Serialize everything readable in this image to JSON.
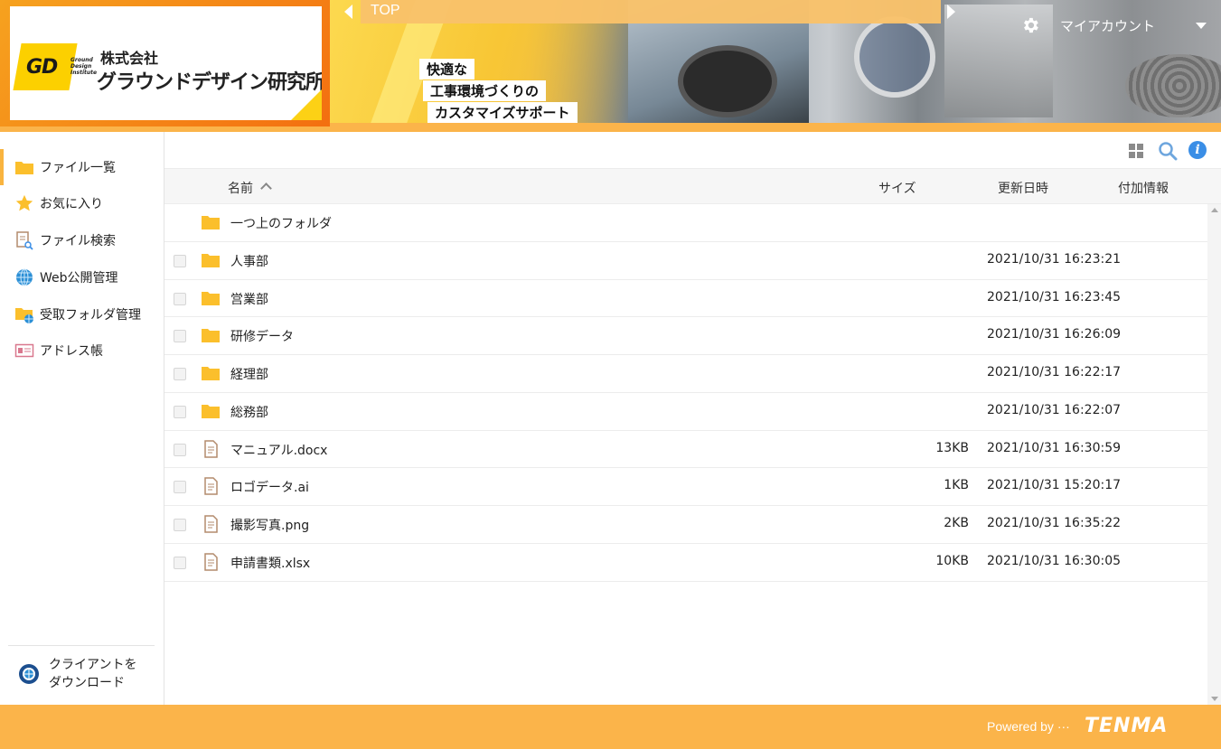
{
  "header": {
    "logo": {
      "mark": "GD",
      "sub_lines": [
        "Ground",
        "Design",
        "Institute"
      ],
      "company_prefix": "株式会社",
      "company_name": "グラウンドデザイン研究所"
    },
    "breadcrumb_top": "TOP",
    "taglines": [
      "快適な",
      "工事環境づくりの",
      "カスタマイズサポート"
    ],
    "account_label": "マイアカウント"
  },
  "sidebar": {
    "items": [
      {
        "label": "ファイル一覧",
        "icon": "folder-icon"
      },
      {
        "label": "お気に入り",
        "icon": "star-icon"
      },
      {
        "label": "ファイル検索",
        "icon": "file-search-icon"
      },
      {
        "label": "Web公開管理",
        "icon": "globe-icon"
      },
      {
        "label": "受取フォルダ管理",
        "icon": "folder-globe-icon"
      },
      {
        "label": "アドレス帳",
        "icon": "address-card-icon"
      }
    ],
    "client_download": [
      "クライアントを",
      "ダウンロード"
    ]
  },
  "table": {
    "columns": {
      "name": "名前",
      "size": "サイズ",
      "date": "更新日時",
      "extra": "付加情報"
    },
    "parent_folder": "一つ上のフォルダ",
    "rows": [
      {
        "type": "folder",
        "name": "人事部",
        "size": "",
        "date": "2021/10/31 16:23:21"
      },
      {
        "type": "folder",
        "name": "営業部",
        "size": "",
        "date": "2021/10/31 16:23:45"
      },
      {
        "type": "folder",
        "name": "研修データ",
        "size": "",
        "date": "2021/10/31 16:26:09"
      },
      {
        "type": "folder",
        "name": "経理部",
        "size": "",
        "date": "2021/10/31 16:22:17"
      },
      {
        "type": "folder",
        "name": "総務部",
        "size": "",
        "date": "2021/10/31 16:22:07"
      },
      {
        "type": "file",
        "name": "マニュアル.docx",
        "size": "13KB",
        "date": "2021/10/31 16:30:59"
      },
      {
        "type": "file",
        "name": "ロゴデータ.ai",
        "size": "1KB",
        "date": "2021/10/31 15:20:17"
      },
      {
        "type": "file",
        "name": "撮影写真.png",
        "size": "2KB",
        "date": "2021/10/31 16:35:22"
      },
      {
        "type": "file",
        "name": "申請書類.xlsx",
        "size": "10KB",
        "date": "2021/10/31 16:30:05"
      }
    ]
  },
  "footer": {
    "powered_by": "Powered by ···",
    "brand": "TENMA"
  },
  "colors": {
    "accent": "#fbb44a",
    "folder": "#fbbf2c",
    "info": "#3a8ee6"
  }
}
